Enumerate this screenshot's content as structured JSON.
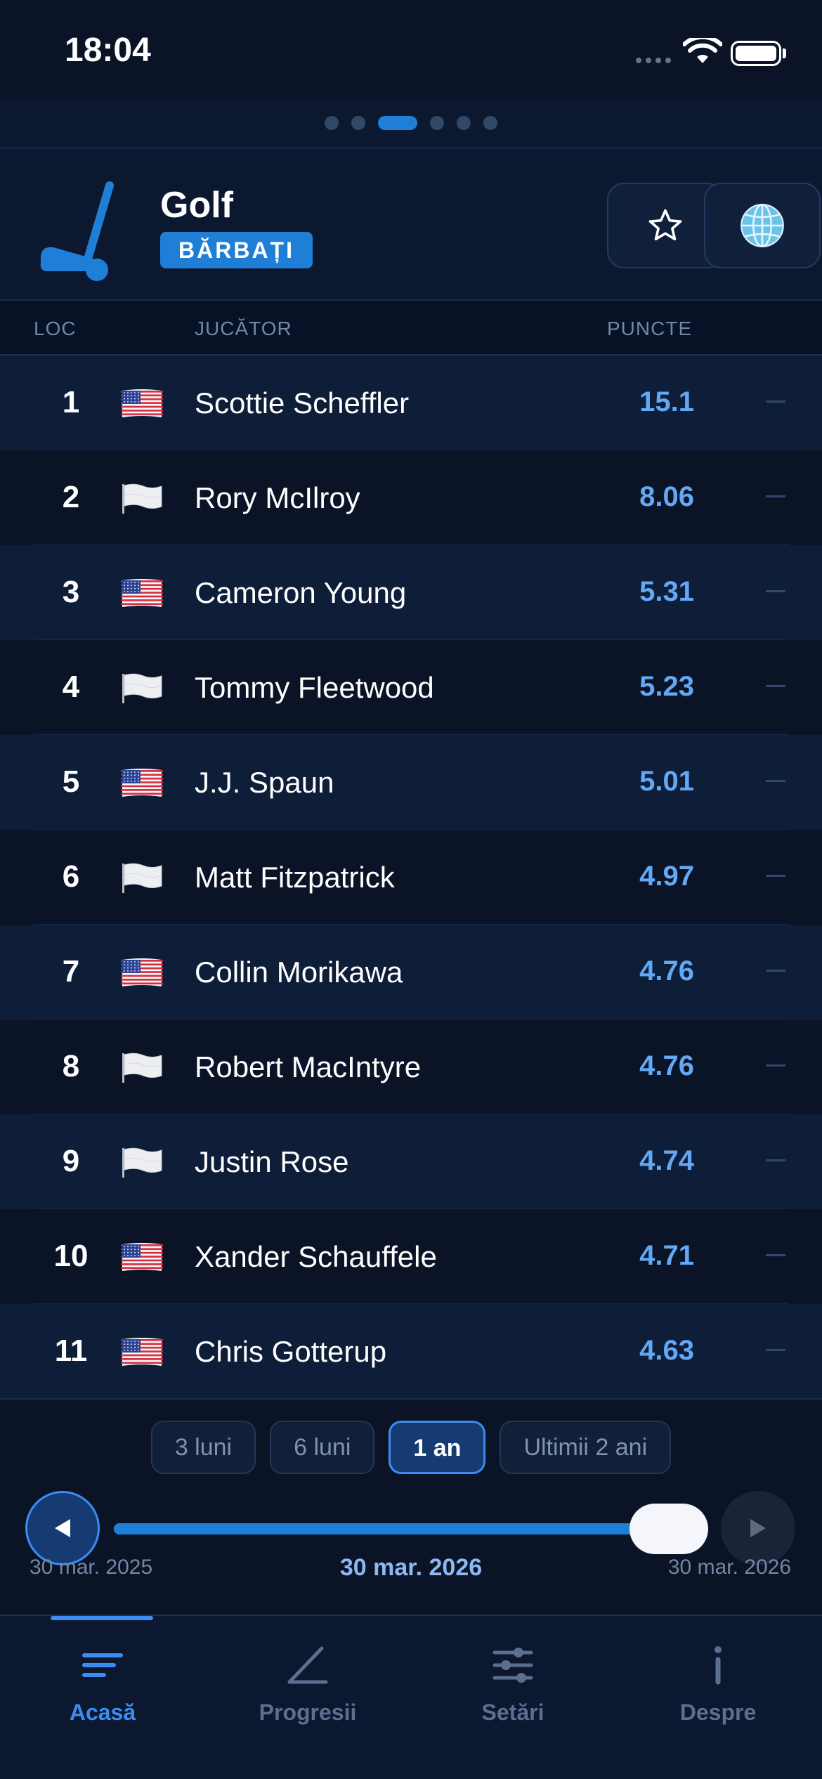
{
  "status_bar": {
    "time": "18:04"
  },
  "pager": {
    "count": 6,
    "active_index": 2
  },
  "header": {
    "sport": "Golf",
    "category": "BĂRBAȚI",
    "sport_icon": "golf-club-icon",
    "favorite_icon": "star-icon",
    "region_icon": "globe-icon"
  },
  "columns": {
    "rank": "LOC",
    "player": "JUCĂTOR",
    "points": "PUNCTE"
  },
  "rows": [
    {
      "rank": "1",
      "flag": "us-flag-icon",
      "name": "Scottie Scheffler",
      "points": "15.1",
      "trend": "—"
    },
    {
      "rank": "2",
      "flag": "white-flag-icon",
      "name": "Rory McIlroy",
      "points": "8.06",
      "trend": "—"
    },
    {
      "rank": "3",
      "flag": "us-flag-icon",
      "name": "Cameron Young",
      "points": "5.31",
      "trend": "—"
    },
    {
      "rank": "4",
      "flag": "white-flag-icon",
      "name": "Tommy Fleetwood",
      "points": "5.23",
      "trend": "—"
    },
    {
      "rank": "5",
      "flag": "us-flag-icon",
      "name": "J.J. Spaun",
      "points": "5.01",
      "trend": "—"
    },
    {
      "rank": "6",
      "flag": "white-flag-icon",
      "name": "Matt Fitzpatrick",
      "points": "4.97",
      "trend": "—"
    },
    {
      "rank": "7",
      "flag": "us-flag-icon",
      "name": "Collin Morikawa",
      "points": "4.76",
      "trend": "—"
    },
    {
      "rank": "8",
      "flag": "white-flag-icon",
      "name": "Robert MacIntyre",
      "points": "4.76",
      "trend": "—"
    },
    {
      "rank": "9",
      "flag": "white-flag-icon",
      "name": "Justin Rose",
      "points": "4.74",
      "trend": "—"
    },
    {
      "rank": "10",
      "flag": "us-flag-icon",
      "name": "Xander Schauffele",
      "points": "4.71",
      "trend": "—"
    },
    {
      "rank": "11",
      "flag": "us-flag-icon",
      "name": "Chris Gotterup",
      "points": "4.63",
      "trend": "—"
    }
  ],
  "range": {
    "options": [
      "3 luni",
      "6 luni",
      "1 an",
      "Ultimii 2 ani"
    ],
    "selected": "1 an",
    "start_date": "30 mar. 2025",
    "current_date": "30 mar. 2026",
    "end_date": "30 mar. 2026",
    "slider_position": 1.0
  },
  "tabs": [
    {
      "label": "Acasă",
      "icon": "home-list-icon",
      "active": true
    },
    {
      "label": "Progresii",
      "icon": "progress-chart-icon",
      "active": false
    },
    {
      "label": "Setări",
      "icon": "settings-sliders-icon",
      "active": false
    },
    {
      "label": "Despre",
      "icon": "info-icon",
      "active": false
    }
  ],
  "colors": {
    "accent": "#1f7fd6",
    "accent_light": "#3d8cf2",
    "points": "#62a8f5",
    "background": "#0a1426"
  }
}
